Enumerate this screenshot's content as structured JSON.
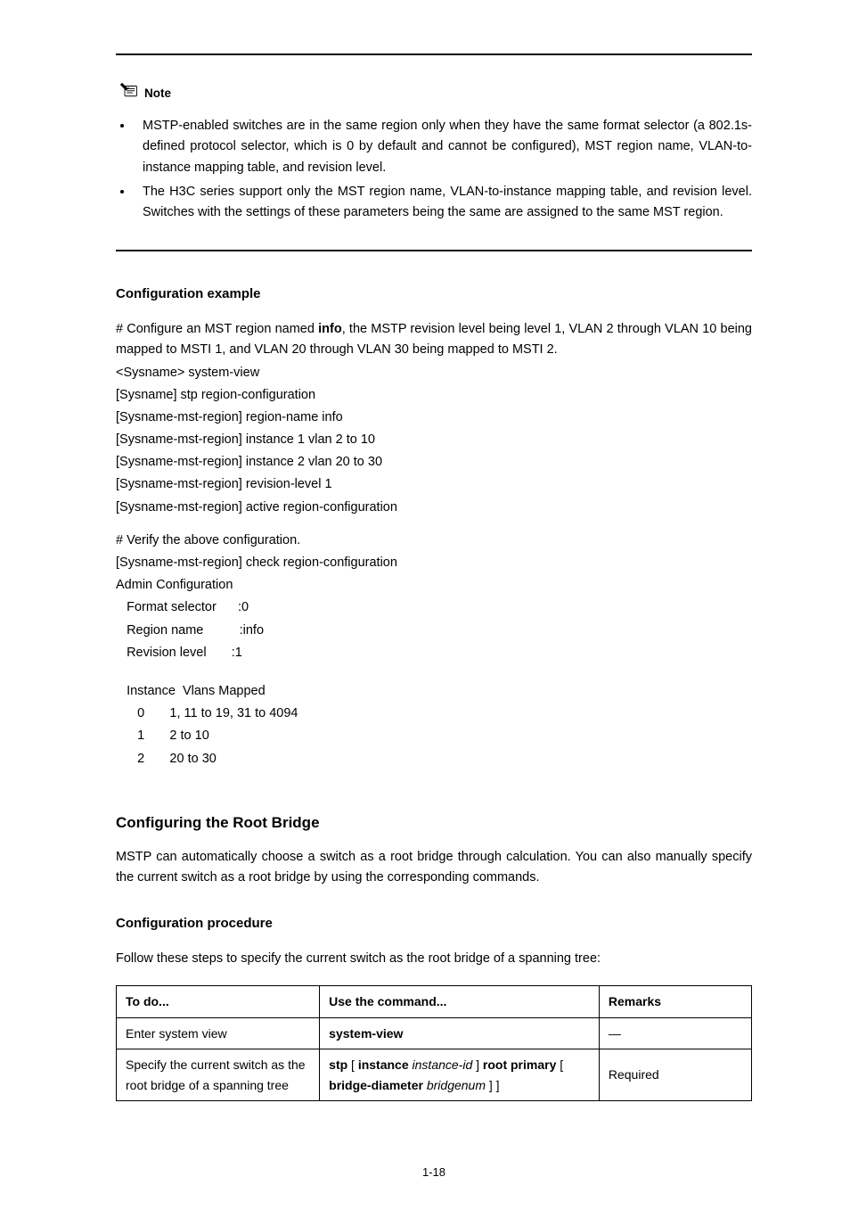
{
  "note": {
    "label": "Note",
    "bullet1": "MSTP-enabled switches are in the same region only when they have the same format selector (a 802.1s-defined protocol selector, which is 0 by default and cannot be configured), MST region name, VLAN-to-instance mapping table, and revision level.",
    "bullet2": "The H3C series support only the MST region name, VLAN-to-instance mapping table, and revision level. Switches with the settings of these parameters being the same are assigned to the same MST region."
  },
  "config_example": {
    "heading": "Configuration example",
    "line1_prefix": "# Configure an MST region named ",
    "line1_name": "info",
    "line1_suffix": ", the MSTP revision level being level 1, VLAN 2 through VLAN 10 being mapped to MSTI 1, and VLAN 20 through VLAN 30 being mapped to MSTI 2.",
    "code1": "<Sysname> system-view",
    "code2": "[Sysname] stp region-configuration",
    "code3": "[Sysname-mst-region] region-name info",
    "code4": "[Sysname-mst-region] instance 1 vlan 2 to 10",
    "code5": "[Sysname-mst-region] instance 2 vlan 20 to 30",
    "code6": "[Sysname-mst-region] revision-level 1",
    "code7": "[Sysname-mst-region] active region-configuration",
    "verify_line": "# Verify the above configuration.",
    "code8": "[Sysname-mst-region] check region-configuration",
    "code9": "Admin Configuration",
    "code10": "   Format selector      :0",
    "code11": "   Region name          :info",
    "code12": "   Revision level       :1",
    "code13": "   Instance  Vlans Mapped",
    "code14": "      0       1, 11 to 19, 31 to 4094",
    "code15": "      1       2 to 10",
    "code16": "      2       20 to 30"
  },
  "root_bridge": {
    "heading": "Configuring the Root Bridge",
    "intro": "MSTP can automatically choose a switch as a root bridge through calculation. You can also manually specify the current switch as a root bridge by using the corresponding commands.",
    "procedure_heading": "Configuration procedure",
    "procedure_intro": "Follow these steps to specify the current switch as the root bridge of a spanning tree:"
  },
  "table": {
    "headers": {
      "todo": "To do...",
      "cmd": "Use the command...",
      "rem": "Remarks"
    },
    "rows": {
      "r1": {
        "todo": "Enter system view",
        "cmd": "system-view",
        "rem": "—"
      },
      "r2": {
        "todo": "Specify the current switch as the root bridge of a spanning tree",
        "cmd_prefix": "stp ",
        "cmd_b1": "[ ",
        "cmd_kw1": "instance",
        "cmd_i1": " instance-id ",
        "cmd_b2": "]",
        "cmd_kw2": " root primary ",
        "cmd_b3": "[ ",
        "cmd_kw3": "bridge-diameter",
        "cmd_i2": " bridgenum ",
        "cmd_b4": "] ]",
        "rem": "Required"
      }
    }
  },
  "footer": {
    "page_number": "1-18"
  }
}
